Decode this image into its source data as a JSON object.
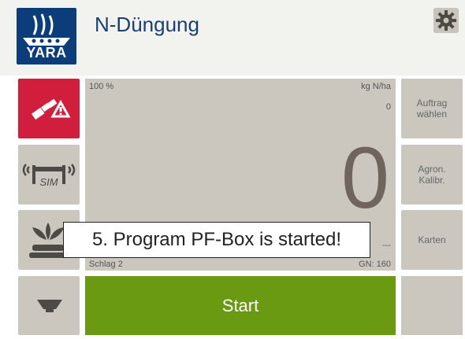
{
  "app": {
    "logo_text": "YARA",
    "title": "N-Düngung"
  },
  "main": {
    "percent": "100 %",
    "unit": "kg N/ha",
    "target_value": "0",
    "current_value": "0",
    "field_label": "Schlag 2",
    "gn_label": "GN:",
    "gn_value": "160",
    "dash": "---"
  },
  "right_menu": [
    {
      "label": "Auftrag\nwählen"
    },
    {
      "label": "Agron.\nKalibr."
    },
    {
      "label": "Karten"
    }
  ],
  "start_label": "Start",
  "tooltip": "5. Program PF-Box is started!",
  "icons": {
    "sim_text": "SIM"
  },
  "colors": {
    "red": "#d21e3d",
    "green": "#6a9a12",
    "panel": "#cbc7bf",
    "brand": "#0a3d7a"
  }
}
